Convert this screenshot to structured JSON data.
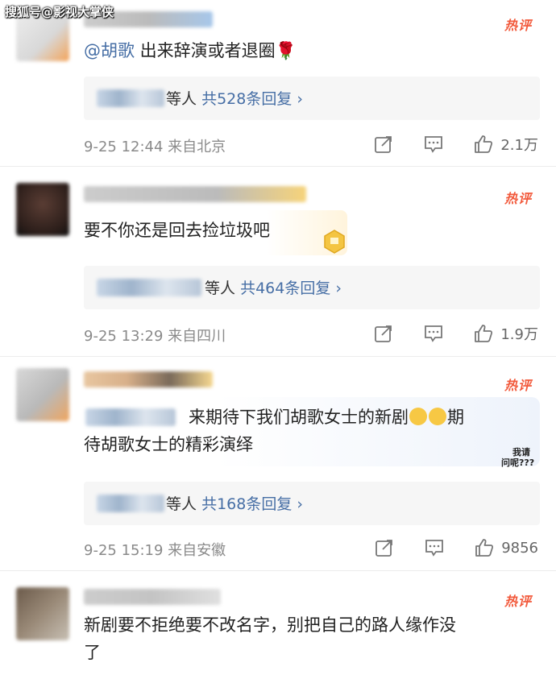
{
  "watermark": "搜狐号@影视大掌侠",
  "hot_label": "热评",
  "comments": [
    {
      "mention": "@胡歌",
      "text": " 出来辞演或者退圈",
      "reply_suffix": "等人",
      "reply_count": "共528条回复",
      "chevron": "›",
      "meta": "9-25 12:44  来自北京",
      "likes": "2.1万"
    },
    {
      "text": "要不你还是回去捡垃圾吧",
      "reply_suffix": "等人",
      "reply_count": "共464条回复",
      "chevron": "›",
      "meta": "9-25 13:29  来自四川",
      "likes": "1.9万"
    },
    {
      "text_line1": "来期待下我们胡歌女士的新剧",
      "text_line1_end": "期",
      "text_line2": "待胡歌女士的精彩演绎",
      "sticker_line1": "我请",
      "sticker_line2": "问呢???",
      "reply_suffix": "等人",
      "reply_count": "共168条回复",
      "chevron": "›",
      "meta": "9-25 15:19  来自安徽",
      "likes": "9856"
    },
    {
      "text_line1": "新剧要不拒绝要不改名字，别把自己的路人缘作没",
      "text_line2": "了"
    }
  ],
  "colors": {
    "link": "#466ea5",
    "hot": "#f25a3c",
    "meta": "#8a8a8a"
  },
  "icons": [
    "share-icon",
    "comment-icon",
    "like-icon"
  ]
}
